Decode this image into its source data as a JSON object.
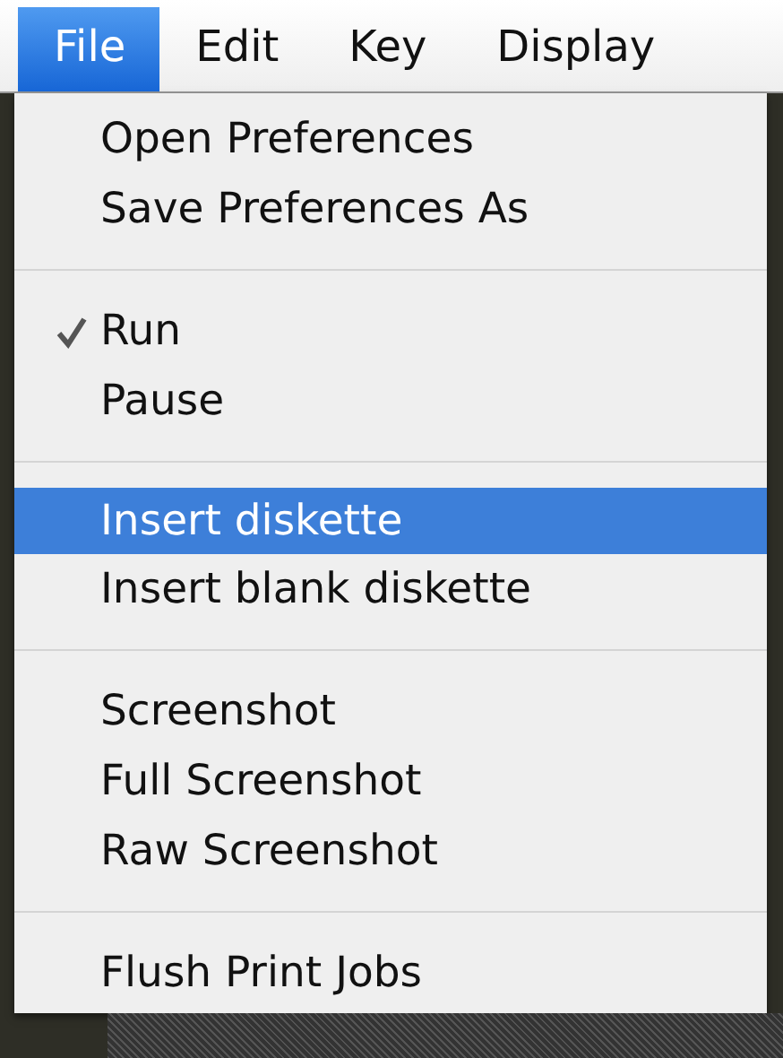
{
  "menubar": [
    {
      "label": "File",
      "selected": true
    },
    {
      "label": "Edit",
      "selected": false
    },
    {
      "label": "Key",
      "selected": false
    },
    {
      "label": "Display",
      "selected": false
    }
  ],
  "menu": {
    "items": [
      {
        "kind": "item",
        "label": "Open Preferences",
        "checked": false,
        "selected": false
      },
      {
        "kind": "item",
        "label": "Save Preferences As",
        "checked": false,
        "selected": false
      },
      {
        "kind": "separator"
      },
      {
        "kind": "item",
        "label": "Run",
        "checked": true,
        "selected": false
      },
      {
        "kind": "item",
        "label": "Pause",
        "checked": false,
        "selected": false
      },
      {
        "kind": "separator"
      },
      {
        "kind": "item",
        "label": "Insert diskette",
        "checked": false,
        "selected": true
      },
      {
        "kind": "item",
        "label": "Insert blank diskette",
        "checked": false,
        "selected": false
      },
      {
        "kind": "separator"
      },
      {
        "kind": "item",
        "label": "Screenshot",
        "checked": false,
        "selected": false
      },
      {
        "kind": "item",
        "label": "Full Screenshot",
        "checked": false,
        "selected": false
      },
      {
        "kind": "item",
        "label": "Raw Screenshot",
        "checked": false,
        "selected": false
      },
      {
        "kind": "separator"
      },
      {
        "kind": "item",
        "label": "Flush Print Jobs",
        "checked": false,
        "selected": false
      }
    ]
  }
}
